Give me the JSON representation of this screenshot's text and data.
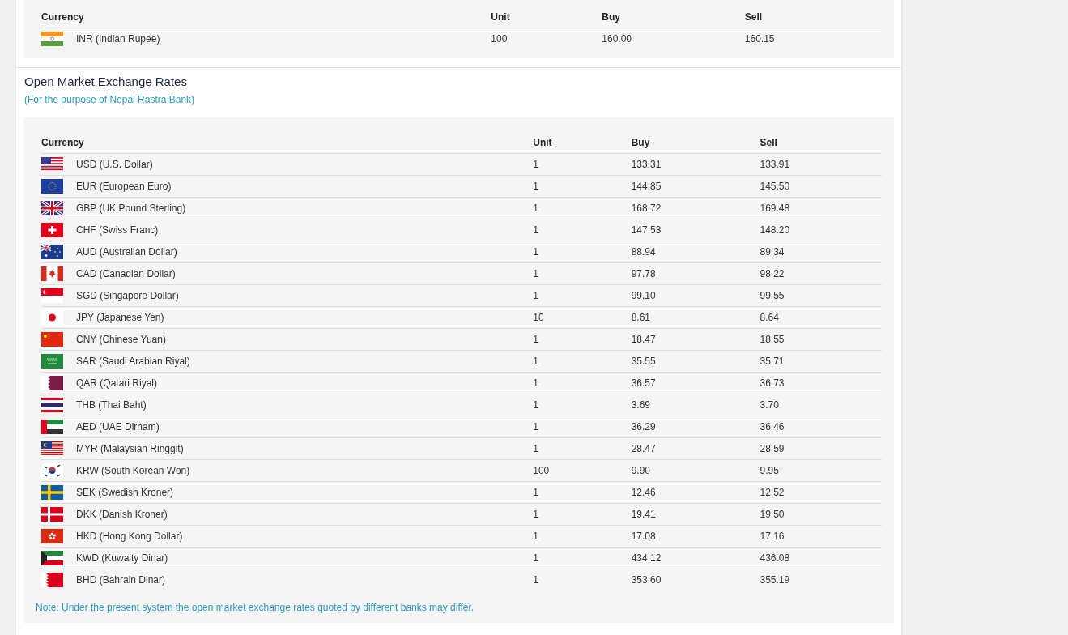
{
  "top_table": {
    "columns": [
      "Currency",
      "Unit",
      "Buy",
      "Sell"
    ],
    "rows": [
      {
        "kind": "in",
        "currency": "INR (Indian Rupee)",
        "unit": "100",
        "buy": "160.00",
        "sell": "160.15"
      }
    ]
  },
  "open_market": {
    "title": "Open Market Exchange Rates",
    "subtitle": "(For the purpose of Nepal Rastra Bank)",
    "columns": [
      "Currency",
      "Unit",
      "Buy",
      "Sell"
    ],
    "rows": [
      {
        "kind": "us",
        "currency": "USD (U.S. Dollar)",
        "unit": "1",
        "buy": "133.31",
        "sell": "133.91"
      },
      {
        "kind": "eu",
        "currency": "EUR (European Euro)",
        "unit": "1",
        "buy": "144.85",
        "sell": "145.50"
      },
      {
        "kind": "gb",
        "currency": "GBP (UK Pound Sterling)",
        "unit": "1",
        "buy": "168.72",
        "sell": "169.48"
      },
      {
        "kind": "ch",
        "currency": "CHF (Swiss Franc)",
        "unit": "1",
        "buy": "147.53",
        "sell": "148.20"
      },
      {
        "kind": "au",
        "currency": "AUD (Australian Dollar)",
        "unit": "1",
        "buy": "88.94",
        "sell": "89.34"
      },
      {
        "kind": "ca",
        "currency": "CAD (Canadian Dollar)",
        "unit": "1",
        "buy": "97.78",
        "sell": "98.22"
      },
      {
        "kind": "sg",
        "currency": "SGD (Singapore Dollar)",
        "unit": "1",
        "buy": "99.10",
        "sell": "99.55"
      },
      {
        "kind": "jp",
        "currency": "JPY (Japanese Yen)",
        "unit": "10",
        "buy": "8.61",
        "sell": "8.64"
      },
      {
        "kind": "cn",
        "currency": "CNY (Chinese Yuan)",
        "unit": "1",
        "buy": "18.47",
        "sell": "18.55"
      },
      {
        "kind": "sa",
        "currency": "SAR (Saudi Arabian Riyal)",
        "unit": "1",
        "buy": "35.55",
        "sell": "35.71"
      },
      {
        "kind": "qa",
        "currency": "QAR (Qatari Riyal)",
        "unit": "1",
        "buy": "36.57",
        "sell": "36.73"
      },
      {
        "kind": "th",
        "currency": "THB (Thai Baht)",
        "unit": "1",
        "buy": "3.69",
        "sell": "3.70"
      },
      {
        "kind": "ae",
        "currency": "AED (UAE Dirham)",
        "unit": "1",
        "buy": "36.29",
        "sell": "36.46"
      },
      {
        "kind": "my",
        "currency": "MYR (Malaysian Ringgit)",
        "unit": "1",
        "buy": "28.47",
        "sell": "28.59"
      },
      {
        "kind": "kr",
        "currency": "KRW (South Korean Won)",
        "unit": "100",
        "buy": "9.90",
        "sell": "9.95"
      },
      {
        "kind": "se",
        "currency": "SEK (Swedish Kroner)",
        "unit": "1",
        "buy": "12.46",
        "sell": "12.52"
      },
      {
        "kind": "dk",
        "currency": "DKK (Danish Kroner)",
        "unit": "1",
        "buy": "19.41",
        "sell": "19.50"
      },
      {
        "kind": "hk",
        "currency": "HKD (Hong Kong Dollar)",
        "unit": "1",
        "buy": "17.08",
        "sell": "17.16"
      },
      {
        "kind": "kw",
        "currency": "KWD (Kuwaity Dinar)",
        "unit": "1",
        "buy": "434.12",
        "sell": "436.08"
      },
      {
        "kind": "bh",
        "currency": "BHD (Bahrain Dinar)",
        "unit": "1",
        "buy": "353.60",
        "sell": "355.19"
      }
    ],
    "note": "Note: Under the present system the open market exchange rates quoted by different banks may differ."
  }
}
